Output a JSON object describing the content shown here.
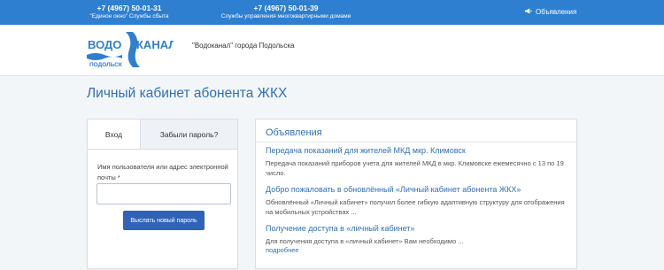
{
  "topbar": {
    "phone1": {
      "number": "+7 (4967) 50-01-31",
      "caption": "\"Единое окно\" Службы сбыта"
    },
    "phone2": {
      "number": "+7 (4967) 50-01-39",
      "caption": "Службы управления многоквартирными домами"
    },
    "announcements_link": "Объявления"
  },
  "header": {
    "logo": {
      "line1": "ВОДО",
      "line2": "КАНАЛ",
      "city": "ПОДОЛЬСК"
    },
    "org_name": "\"Водоканал\" города Подольска"
  },
  "page_title": "Личный кабинет абонента ЖКХ",
  "login": {
    "tabs": [
      "Вход",
      "Забыли пароль?"
    ],
    "active_tab": "Забыли пароль?",
    "field_label": "Имя пользователя или адрес электронной почты *",
    "field_value": "",
    "submit_label": "Выслать новый пароль"
  },
  "announcements": {
    "heading": "Объявления",
    "items": [
      {
        "title": "Передача показаний для жителей МКД мкр. Климовск",
        "text": "Передача показаний приборов учета для жителей МКД в мкр. Климовске ежемесячно с 13 по 19 число."
      },
      {
        "title": "Добро пожаловать в обновлённый «Личный кабинет абонента ЖКХ»",
        "text": "Обновлённый «Личный кабинет» получил более гибкую адаптивную структуру для отображения на мобильных устройствах ..."
      },
      {
        "title": "Получение доступа в «личный кабинет»",
        "text": "Для получения доступа в «личный кабинет» Вам необходимо ..."
      }
    ],
    "more_label": "подробнее"
  },
  "colors": {
    "brand_blue": "#2f7fd0",
    "button_blue": "#2f63b7",
    "link_blue": "#2f6fb8"
  },
  "icons": {
    "announcements": "megaphone-icon"
  }
}
